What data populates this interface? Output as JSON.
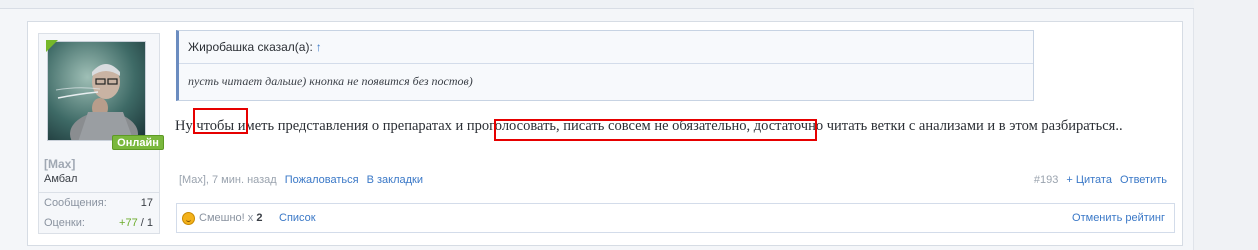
{
  "user": {
    "name": "[Max]",
    "title": "Амбал",
    "online_label": "Онлайн",
    "stats": [
      {
        "label": "Сообщения:",
        "value": "17"
      },
      {
        "label": "Оценки:",
        "value_pos": "+77",
        "value_rest": " / 1"
      }
    ]
  },
  "quote": {
    "author": "Жиробашка сказал(а):",
    "arrow": "↑",
    "text": "пусть читает дальше) кнопка не появится без постов)"
  },
  "message": {
    "text": "Ну чтобы иметь представления о препаратах и проголосовать, писать совсем не обязательно, достаточно читать ветки с анализами и в этом разбираться.."
  },
  "meta": {
    "author_time": "[Max], 7 мин. назад",
    "report": "Пожаловаться",
    "bookmark": "В закладки",
    "post_number": "#193",
    "quote": "+ Цитата",
    "reply": "Ответить"
  },
  "ratings": {
    "label": "Смешно!",
    "times": " x ",
    "count": "2",
    "list": "Список",
    "cancel": "Отменить рейтинг"
  },
  "colors": {
    "highlight": "#e60000",
    "online": "#7ab83d",
    "link": "#3a78c7"
  }
}
